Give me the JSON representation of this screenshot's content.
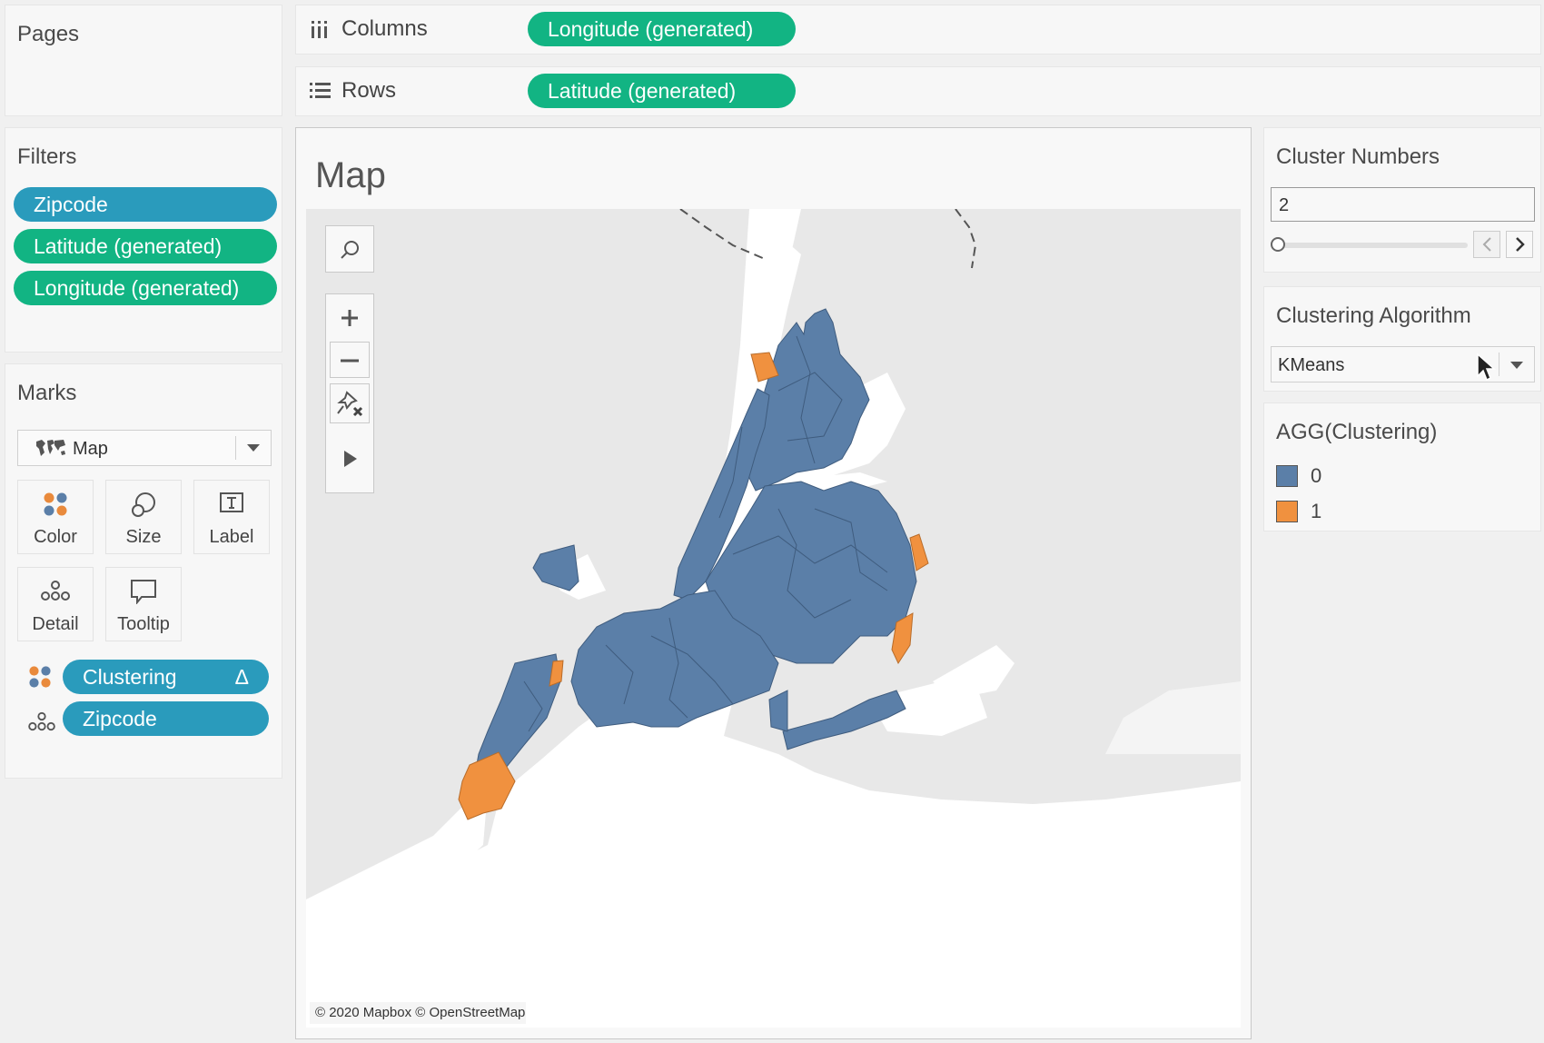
{
  "pages_panel": {
    "title": "Pages"
  },
  "shelves": {
    "columns": {
      "label": "Columns",
      "pill": "Longitude (generated)"
    },
    "rows": {
      "label": "Rows",
      "pill": "Latitude (generated)"
    }
  },
  "filters": {
    "title": "Filters",
    "items": [
      "Zipcode",
      "Latitude (generated)",
      "Longitude (generated)"
    ]
  },
  "marks": {
    "title": "Marks",
    "type_value": "Map",
    "cards": [
      "Color",
      "Size",
      "Label",
      "Detail",
      "Tooltip"
    ],
    "fields": [
      {
        "label": "Clustering",
        "suffix": "Δ"
      },
      {
        "label": "Zipcode"
      }
    ]
  },
  "view": {
    "title": "Map",
    "attribution": "© 2020 Mapbox © OpenStreetMap",
    "colors": {
      "cluster_0": "#5b7fa8",
      "cluster_1": "#f0913f",
      "water": "#ffffff",
      "land": "#e8e8e8"
    }
  },
  "parameters": {
    "cluster_numbers": {
      "title": "Cluster Numbers",
      "value": "2"
    },
    "algorithm": {
      "title": "Clustering Algorithm",
      "value": "KMeans"
    }
  },
  "legend": {
    "title": "AGG(Clustering)",
    "items": [
      {
        "label": "0",
        "color": "#5b7fa8"
      },
      {
        "label": "1",
        "color": "#f0913f"
      }
    ]
  }
}
